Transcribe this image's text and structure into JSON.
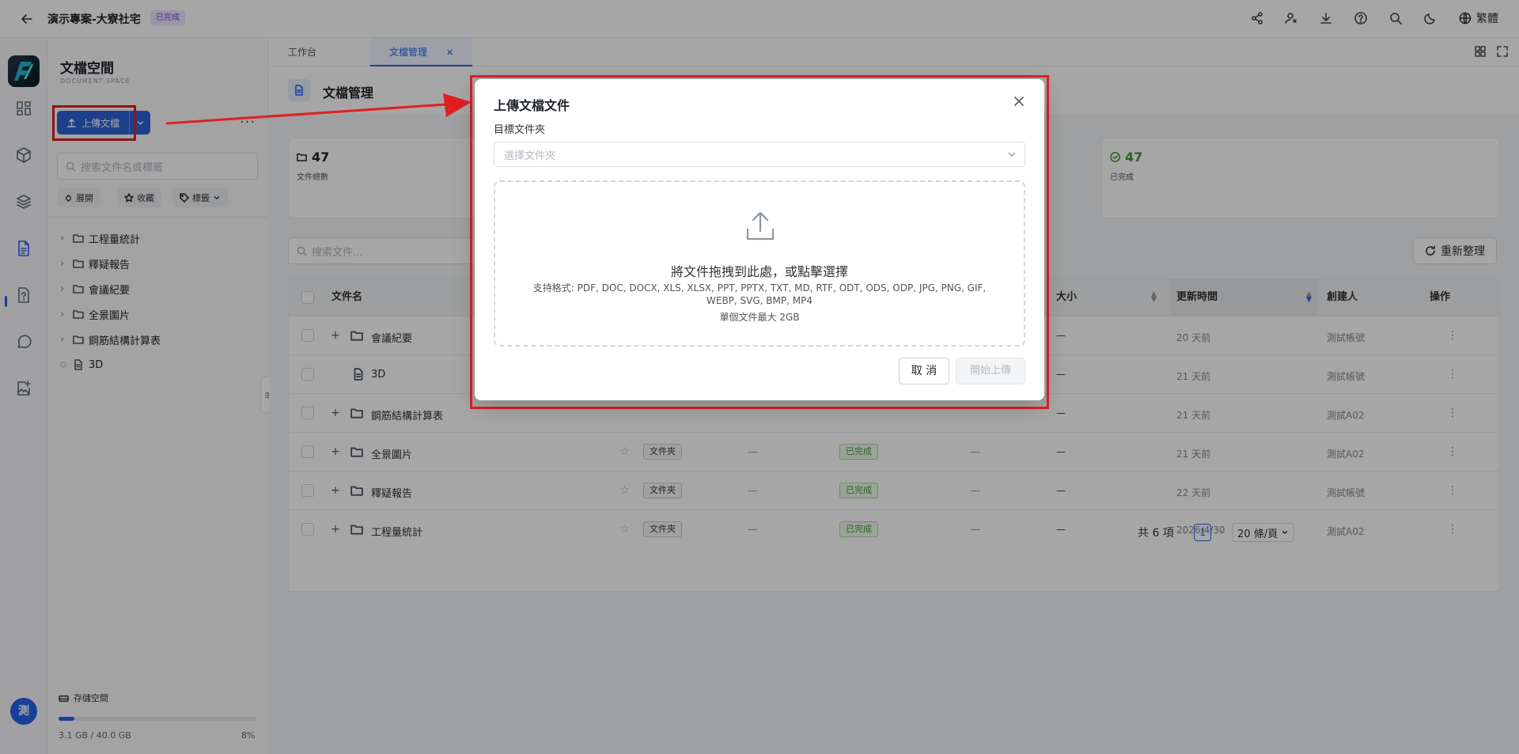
{
  "topbar": {
    "title": "演示專案-大寮社宅",
    "status_badge": "已完成",
    "language": "繁體",
    "icons": [
      "back-arrow-icon",
      "share-icon",
      "user-switch-icon",
      "download-icon",
      "help-icon",
      "search-icon",
      "moon-icon",
      "globe-icon"
    ]
  },
  "rail": {
    "items": [
      "dashboard-icon",
      "cube-icon",
      "layers-icon",
      "document-icon",
      "file-question-icon",
      "chat-icon",
      "image-add-icon"
    ],
    "avatar": "測"
  },
  "sidebar": {
    "title": "文檔空間",
    "subtitle": "DOCUMENT SPACE",
    "upload_label": "上傳文檔",
    "search_placeholder": "搜索文件名或標籤",
    "chips": {
      "expand": "展開",
      "favorite": "收藏",
      "tags": "標籤"
    },
    "tree": [
      {
        "label": "工程量統計",
        "type": "folder"
      },
      {
        "label": "釋疑報告",
        "type": "folder"
      },
      {
        "label": "會議紀要",
        "type": "folder"
      },
      {
        "label": "全景圖片",
        "type": "folder"
      },
      {
        "label": "鋼筋結構計算表",
        "type": "folder"
      },
      {
        "label": "3D",
        "type": "file"
      }
    ],
    "storage_label": "存儲空間",
    "storage_info": "3.1 GB / 40.0 GB",
    "storage_percent": "8%",
    "storage_fraction": 0.08
  },
  "tabs": [
    {
      "label": "工作台",
      "active": false
    },
    {
      "label": "文檔管理",
      "active": true
    }
  ],
  "page": {
    "title": "文檔管理"
  },
  "stats": [
    {
      "value": "47",
      "label": "文件總數"
    },
    {
      "value": "47",
      "label": "已完成"
    }
  ],
  "toolbar": {
    "search_placeholder": "搜索文件...",
    "refresh_label": "重新整理"
  },
  "table": {
    "headers": {
      "name": "文件名",
      "size": "大小",
      "updated": "更新時間",
      "creator": "創建人",
      "actions": "操作"
    },
    "rows": [
      {
        "name": "會議紀要",
        "kind": "folder",
        "type_tag": "",
        "status": "",
        "size": "—",
        "updated": "20 天前",
        "creator": "測試帳號"
      },
      {
        "name": "3D",
        "kind": "file",
        "type_tag": "",
        "status": "",
        "size": "—",
        "updated": "21 天前",
        "creator": "測試帳號"
      },
      {
        "name": "鋼筋結構計算表",
        "kind": "folder",
        "type_tag": "",
        "status": "",
        "size": "—",
        "updated": "21 天前",
        "creator": "測試A02"
      },
      {
        "name": "全景圖片",
        "kind": "folder",
        "type_tag": "文件夾",
        "status": "已完成",
        "size": "—",
        "updated": "21 天前",
        "creator": "測試A02"
      },
      {
        "name": "釋疑報告",
        "kind": "folder",
        "type_tag": "文件夾",
        "status": "已完成",
        "size": "—",
        "updated": "22 天前",
        "creator": "測試帳號"
      },
      {
        "name": "工程量統計",
        "kind": "folder",
        "type_tag": "文件夾",
        "status": "已完成",
        "size": "—",
        "updated": "2026/4/30",
        "creator": "測試A02"
      }
    ],
    "dash": "—",
    "more": "⋮"
  },
  "pagination": {
    "total": "共 6 項",
    "current": "1",
    "page_size": "20 條/頁"
  },
  "modal": {
    "title": "上傳文檔文件",
    "folder_label": "目標文件夾",
    "folder_placeholder": "選擇文件夾",
    "drop_text": "將文件拖拽到此處，或點擊選擇",
    "formats": "支持格式: PDF, DOC, DOCX, XLS, XLSX, PPT, PPTX, TXT, MD, RTF, ODT, ODS, ODP, JPG, PNG, GIF, WEBP, SVG, BMP, MP4",
    "max_size": "單個文件最大 2GB",
    "cancel_label": "取 消",
    "start_label": "開始上傳"
  },
  "annotation_color": "#e02020"
}
